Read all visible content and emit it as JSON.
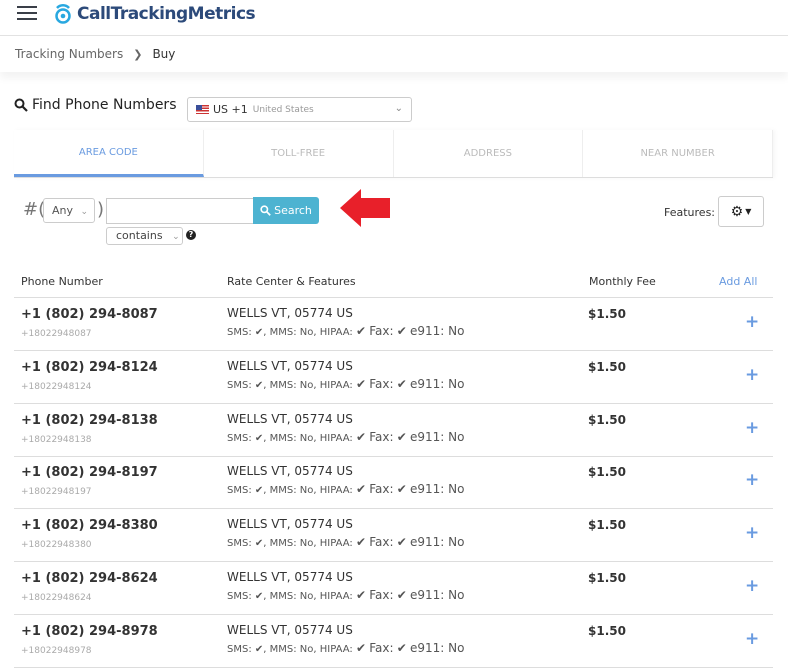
{
  "header": {
    "brand": "CallTrackingMetrics"
  },
  "breadcrumb": {
    "parent": "Tracking Numbers",
    "current": "Buy"
  },
  "find": {
    "title": "Find Phone Numbers",
    "country_code": "US +1",
    "country_name": "United States"
  },
  "tabs": [
    {
      "label": "AREA CODE",
      "active": true
    },
    {
      "label": "TOLL-FREE"
    },
    {
      "label": "ADDRESS"
    },
    {
      "label": "NEAR NUMBER"
    }
  ],
  "search": {
    "prefix": "#(",
    "suffix": ")",
    "area_select": "Any",
    "input_value": "",
    "button": "Search",
    "match_select": "contains",
    "help": "?"
  },
  "features": {
    "label": "Features:"
  },
  "table": {
    "headers": {
      "phone": "Phone Number",
      "rate": "Rate Center & Features",
      "fee": "Monthly Fee",
      "add_all": "Add All"
    },
    "rows": [
      {
        "number": "+1 (802) 294-8087",
        "raw": "+18022948087",
        "rate_center": "WELLS VT, 05774 US",
        "fee": "$1.50"
      },
      {
        "number": "+1 (802) 294-8124",
        "raw": "+18022948124",
        "rate_center": "WELLS VT, 05774 US",
        "fee": "$1.50"
      },
      {
        "number": "+1 (802) 294-8138",
        "raw": "+18022948138",
        "rate_center": "WELLS VT, 05774 US",
        "fee": "$1.50"
      },
      {
        "number": "+1 (802) 294-8197",
        "raw": "+18022948197",
        "rate_center": "WELLS VT, 05774 US",
        "fee": "$1.50"
      },
      {
        "number": "+1 (802) 294-8380",
        "raw": "+18022948380",
        "rate_center": "WELLS VT, 05774 US",
        "fee": "$1.50"
      },
      {
        "number": "+1 (802) 294-8624",
        "raw": "+18022948624",
        "rate_center": "WELLS VT, 05774 US",
        "fee": "$1.50"
      },
      {
        "number": "+1 (802) 294-8978",
        "raw": "+18022948978",
        "rate_center": "WELLS VT, 05774 US",
        "fee": "$1.50"
      }
    ],
    "features_text": {
      "sms": "SMS:",
      "mms": ", MMS: No, HIPAA:",
      "fax": "Fax:",
      "e911": "e911: No"
    }
  },
  "colors": {
    "accent": "#6a9be0",
    "search_button": "#4db3d1",
    "arrow": "#e8202a",
    "brand": "#2c4a7a"
  }
}
